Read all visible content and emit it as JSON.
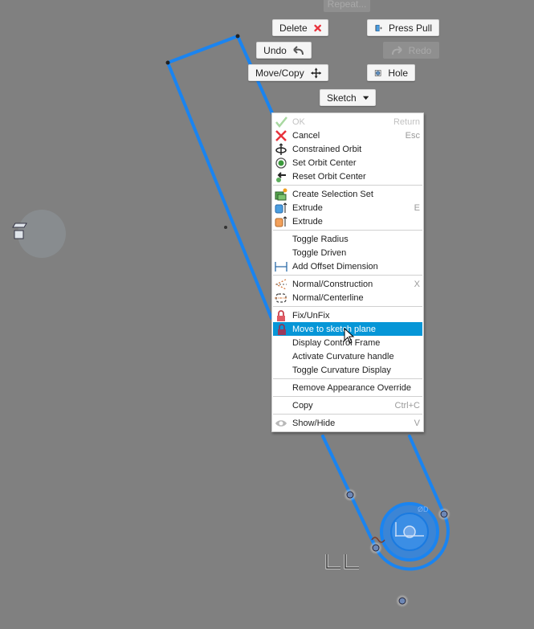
{
  "marking_menu": {
    "repeat_label": "Repeat...",
    "delete_label": "Delete",
    "press_pull_label": "Press Pull",
    "undo_label": "Undo",
    "redo_label": "Redo",
    "move_copy_label": "Move/Copy",
    "hole_label": "Hole",
    "sketch_label": "Sketch"
  },
  "context_menu": {
    "groups": [
      [
        {
          "label": "OK",
          "shortcut": "Return",
          "icon": "checkmark-icon",
          "disabled": true
        },
        {
          "label": "Cancel",
          "shortcut": "Esc",
          "icon": "cancel-x-icon"
        },
        {
          "label": "Constrained Orbit",
          "shortcut": "",
          "icon": "constrained-orbit-icon"
        },
        {
          "label": "Set Orbit Center",
          "shortcut": "",
          "icon": "orbit-center-icon"
        },
        {
          "label": "Reset Orbit Center",
          "shortcut": "",
          "icon": "reset-orbit-icon"
        }
      ],
      [
        {
          "label": "Create Selection Set",
          "shortcut": "",
          "icon": "selection-set-icon"
        },
        {
          "label": "Extrude",
          "shortcut": "E",
          "icon": "extrude-blue-icon"
        },
        {
          "label": "Extrude",
          "shortcut": "",
          "icon": "extrude-orange-icon"
        }
      ],
      [
        {
          "label": "Toggle Radius",
          "shortcut": "",
          "icon": ""
        },
        {
          "label": "Toggle Driven",
          "shortcut": "",
          "icon": ""
        },
        {
          "label": "Add Offset Dimension",
          "shortcut": "",
          "icon": "offset-dimension-icon"
        }
      ],
      [
        {
          "label": "Normal/Construction",
          "shortcut": "X",
          "icon": "construction-icon"
        },
        {
          "label": "Normal/Centerline",
          "shortcut": "",
          "icon": "centerline-icon"
        }
      ],
      [
        {
          "label": "Fix/UnFix",
          "shortcut": "",
          "icon": "lock-icon"
        },
        {
          "label": "Move to sketch plane",
          "shortcut": "",
          "icon": "lock-icon",
          "highlighted": true
        },
        {
          "label": "Display Control Frame",
          "shortcut": "",
          "icon": ""
        },
        {
          "label": "Activate Curvature handle",
          "shortcut": "",
          "icon": ""
        },
        {
          "label": "Toggle Curvature Display",
          "shortcut": "",
          "icon": ""
        }
      ],
      [
        {
          "label": "Remove Appearance Override",
          "shortcut": "",
          "icon": ""
        }
      ],
      [
        {
          "label": "Copy",
          "shortcut": "Ctrl+C",
          "icon": ""
        }
      ],
      [
        {
          "label": "Show/Hide",
          "shortcut": "V",
          "icon": "eye-icon"
        }
      ]
    ]
  },
  "colors": {
    "canvas_bg": "#808080",
    "sketch_blue": "#1a84f0",
    "highlight": "#0696d7",
    "delete_red": "#e8323c"
  }
}
